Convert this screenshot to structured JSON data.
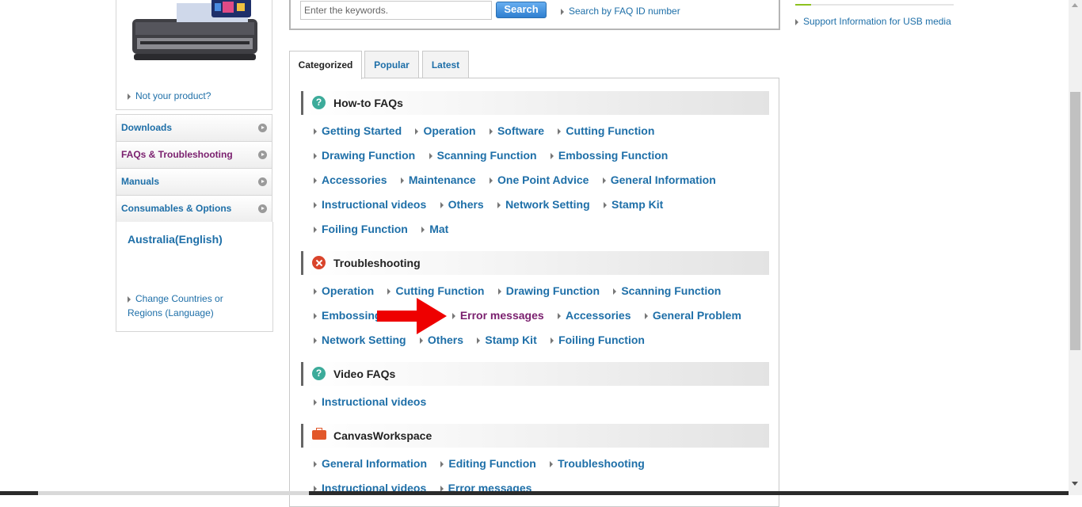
{
  "product": {
    "not_your_product": "Not your product?"
  },
  "sidebar": {
    "items": [
      {
        "label": "Downloads"
      },
      {
        "label": "FAQs & Troubleshooting"
      },
      {
        "label": "Manuals"
      },
      {
        "label": "Consumables & Options"
      }
    ],
    "region": "Australia(English)",
    "change_region": "Change Countries or Regions (Language)"
  },
  "search": {
    "placeholder": "Enter the keywords.",
    "button": "Search",
    "faq_id_link": "Search by FAQ ID number"
  },
  "right": {
    "usb_link": "Support Information for USB media"
  },
  "tabs": [
    {
      "label": "Categorized"
    },
    {
      "label": "Popular"
    },
    {
      "label": "Latest"
    }
  ],
  "sections": {
    "howto": {
      "title": "How-to FAQs",
      "rows": [
        [
          "Getting Started",
          "Operation",
          "Software",
          "Cutting Function"
        ],
        [
          "Drawing Function",
          "Scanning Function",
          "Embossing Function"
        ],
        [
          "Accessories",
          "Maintenance",
          "One Point Advice",
          "General Information"
        ],
        [
          "Instructional videos",
          "Others",
          "Network Setting",
          "Stamp Kit"
        ],
        [
          "Foiling Function",
          "Mat"
        ]
      ]
    },
    "troubleshooting": {
      "title": "Troubleshooting",
      "rows": [
        [
          "Operation",
          "Cutting Function",
          "Drawing Function",
          "Scanning Function"
        ],
        [
          "Embossing",
          "Error messages",
          "Accessories",
          "General Problem"
        ],
        [
          "Network Setting",
          "Others",
          "Stamp Kit",
          "Foiling Function"
        ]
      ]
    },
    "video": {
      "title": "Video FAQs",
      "rows": [
        [
          "Instructional videos"
        ]
      ]
    },
    "canvas": {
      "title": "CanvasWorkspace",
      "rows": [
        [
          "General Information",
          "Editing Function",
          "Troubleshooting"
        ],
        [
          "Instructional videos",
          "Error messages"
        ]
      ]
    }
  },
  "colors": {
    "link": "#1e6fa8",
    "visited": "#7a1f6e",
    "annotation_arrow": "#ee0000"
  }
}
